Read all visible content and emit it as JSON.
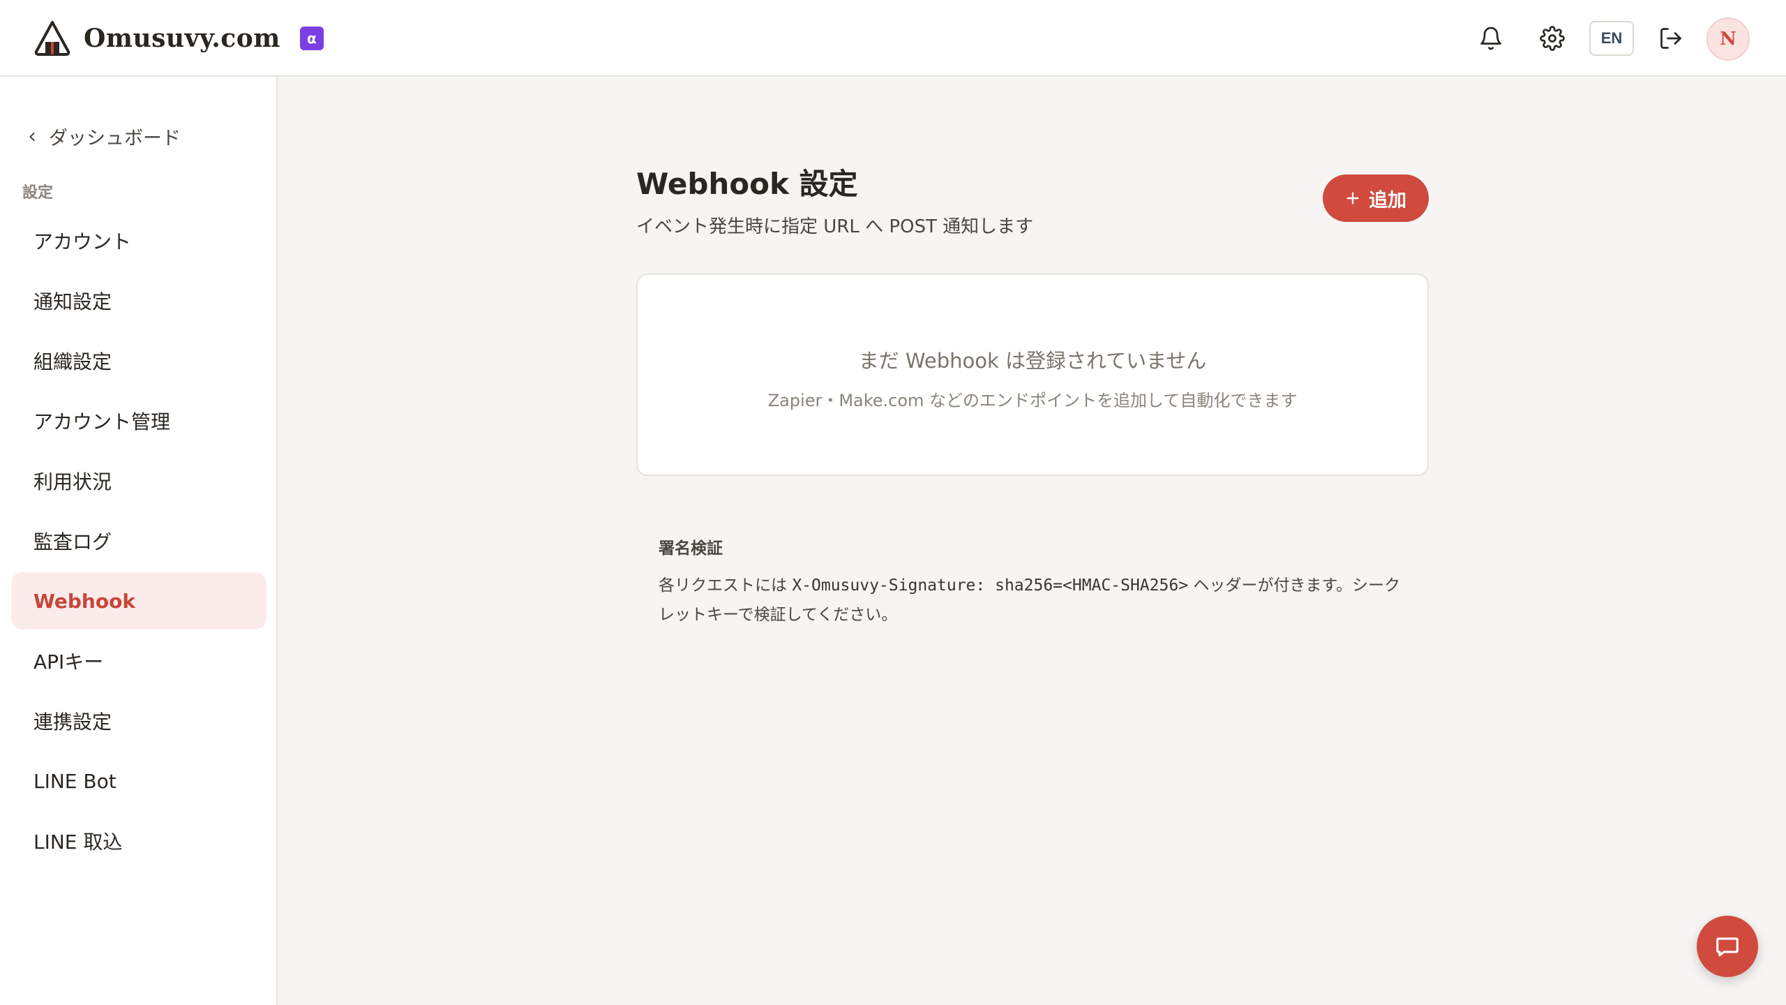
{
  "header": {
    "brand_name": "Omusuvy.com",
    "badge": "α",
    "language_button": "EN",
    "avatar_initial": "N",
    "icons": [
      "onigiri-logo-icon",
      "bell-icon",
      "gear-icon",
      "logout-icon"
    ]
  },
  "sidebar": {
    "back_label": "ダッシュボード",
    "section_label": "設定",
    "items": [
      {
        "label": "アカウント",
        "active": false
      },
      {
        "label": "通知設定",
        "active": false
      },
      {
        "label": "組織設定",
        "active": false
      },
      {
        "label": "アカウント管理",
        "active": false
      },
      {
        "label": "利用状況",
        "active": false
      },
      {
        "label": "監査ログ",
        "active": false
      },
      {
        "label": "Webhook",
        "active": true
      },
      {
        "label": "APIキー",
        "active": false
      },
      {
        "label": "連携設定",
        "active": false
      },
      {
        "label": "LINE Bot",
        "active": false
      },
      {
        "label": "LINE 取込",
        "active": false
      }
    ]
  },
  "main": {
    "title": "Webhook 設定",
    "subtitle": "イベント発生時に指定 URL へ POST 通知します",
    "add_button_label": "追加",
    "empty_title": "まだ Webhook は登録されていません",
    "empty_description": "Zapier・Make.com などのエンドポイントを追加して自動化できます",
    "signature": {
      "title": "署名検証",
      "text_before": "各リクエストには ",
      "code": "X-Omusuvy-Signature: sha256=<HMAC-SHA256>",
      "text_after": " ヘッダーが付きます。シークレットキーで検証してください。"
    }
  },
  "colors": {
    "accent": "#d04a3e",
    "active_bg": "#fbeceb",
    "badge": "#7b3fe4",
    "page_bg": "#f6f5f3"
  }
}
